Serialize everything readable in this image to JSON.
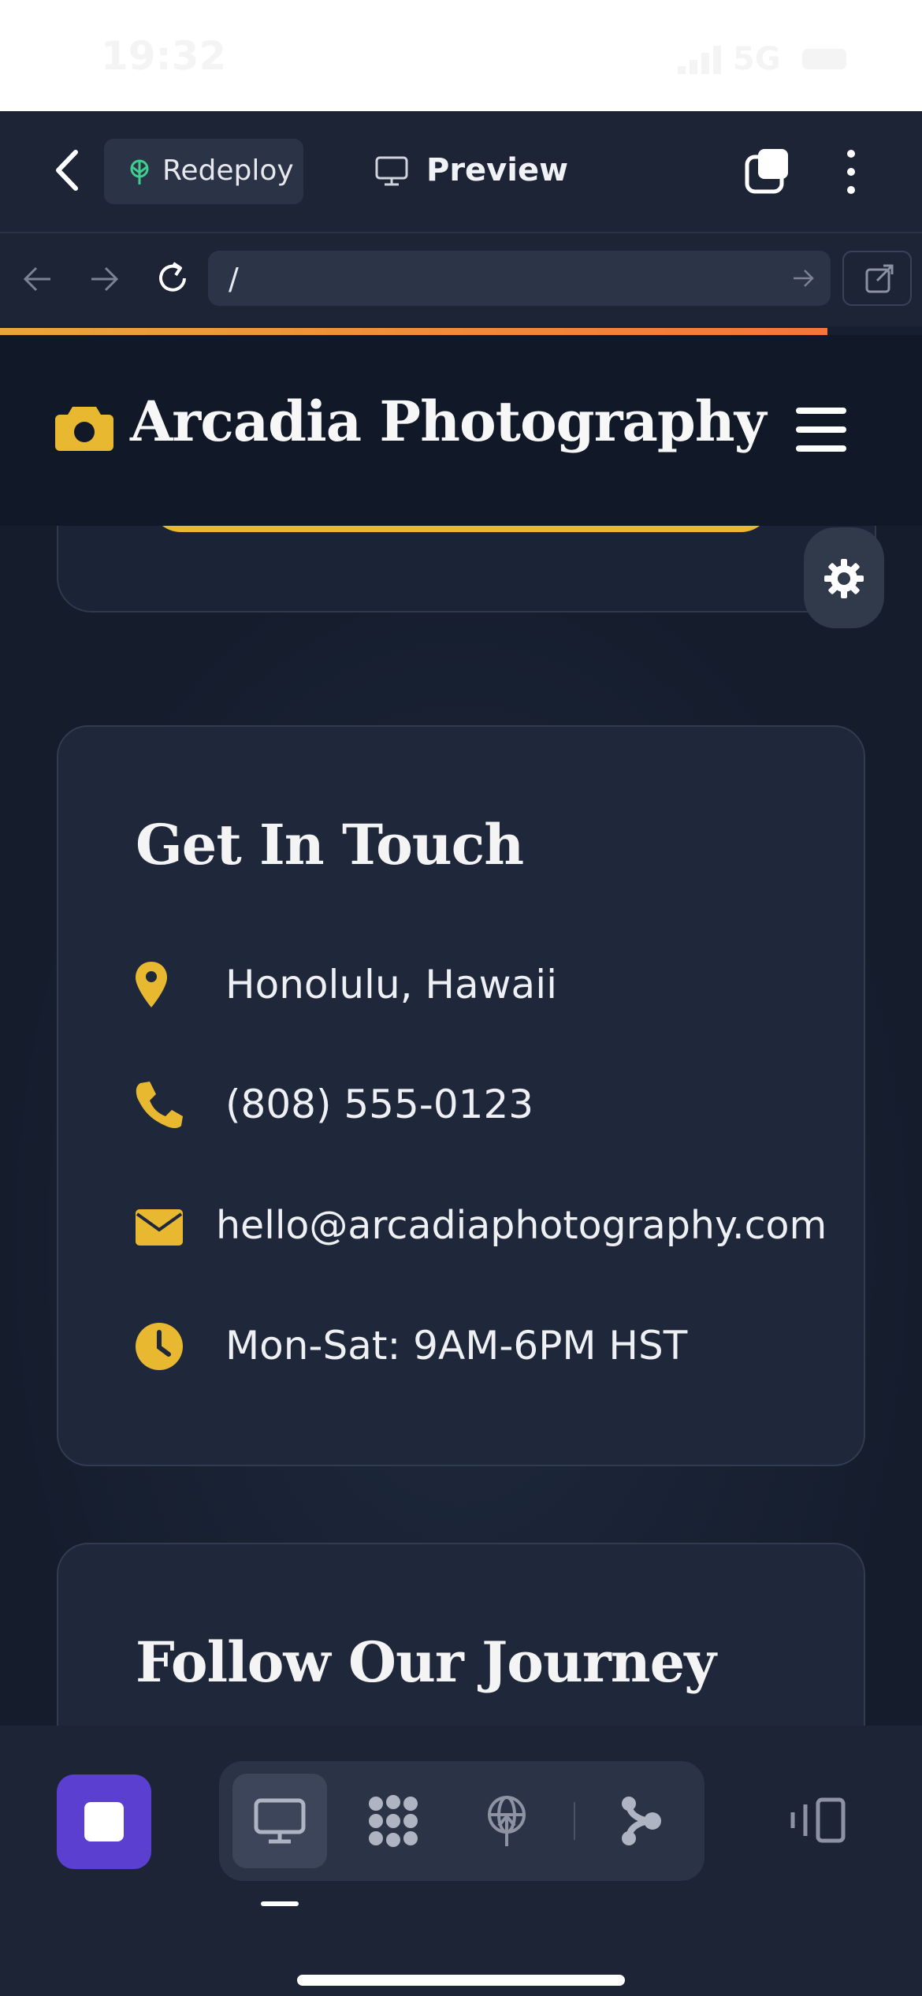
{
  "status_bar": {
    "time": "19:32",
    "network": "5G"
  },
  "app_toolbar": {
    "redeploy_label": "Redeploy",
    "preview_label": "Preview"
  },
  "url_bar": {
    "path": "/"
  },
  "site": {
    "brand": "Arcadia Photography",
    "get_in_touch": {
      "title": "Get In Touch",
      "location": "Honolulu, Hawaii",
      "phone": "(808) 555-0123",
      "email": "hello@arcadiaphotography.com",
      "hours": "Mon-Sat: 9AM-6PM HST"
    },
    "follow": {
      "title": "Follow Our Journey"
    }
  },
  "icons": {
    "accent": "#e8b830",
    "location": "map-pin-icon",
    "phone": "phone-icon",
    "email": "envelope-icon",
    "hours": "clock-icon",
    "logo": "camera-icon"
  },
  "colors": {
    "brand_purple": "#5a3fd0",
    "progress_start": "#e9a63a",
    "progress_end": "#f5753a"
  }
}
